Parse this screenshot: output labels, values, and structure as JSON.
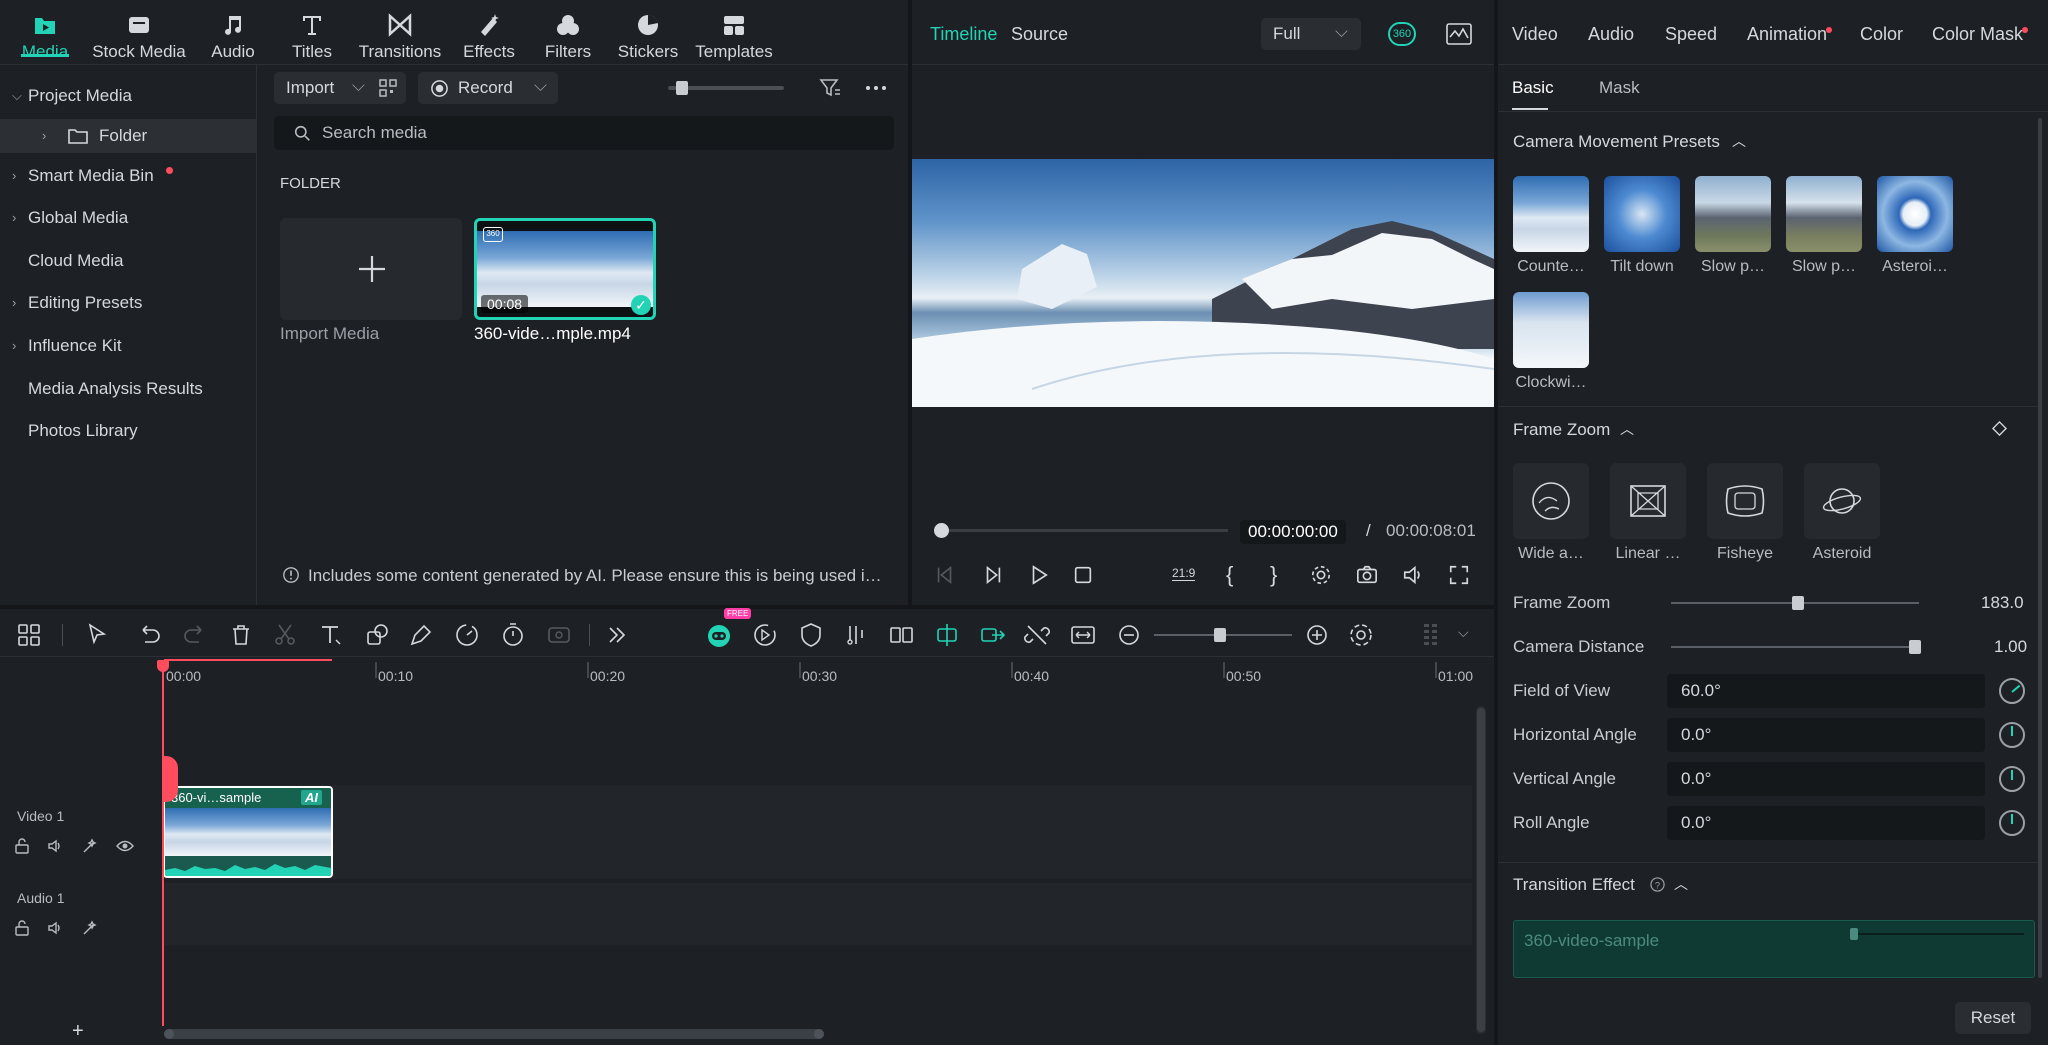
{
  "media_tabs": [
    {
      "label": "Media",
      "icon": "media-folder-icon",
      "active": true
    },
    {
      "label": "Stock Media",
      "icon": "stock-media-icon"
    },
    {
      "label": "Audio",
      "icon": "music-note-icon"
    },
    {
      "label": "Titles",
      "icon": "titles-icon"
    },
    {
      "label": "Transitions",
      "icon": "transitions-icon"
    },
    {
      "label": "Effects",
      "icon": "effects-icon"
    },
    {
      "label": "Filters",
      "icon": "filters-icon"
    },
    {
      "label": "Stickers",
      "icon": "stickers-icon"
    },
    {
      "label": "Templates",
      "icon": "templates-icon"
    }
  ],
  "sidebar": {
    "items": [
      {
        "label": "Project Media"
      },
      {
        "label": "Folder"
      },
      {
        "label": "Smart Media Bin"
      },
      {
        "label": "Global Media"
      },
      {
        "label": "Cloud Media"
      },
      {
        "label": "Editing Presets"
      },
      {
        "label": "Influence Kit"
      },
      {
        "label": "Media Analysis Results"
      },
      {
        "label": "Photos Library"
      }
    ]
  },
  "media": {
    "import_label": "Import",
    "record_label": "Record",
    "search_placeholder": "Search media",
    "section_title": "FOLDER",
    "import_media_label": "Import Media",
    "clip_name": "360-vide…mple.mp4",
    "clip_duration": "00:08",
    "clip_badge": "360",
    "ai_notice": "Includes some content generated by AI. Please ensure this is being used i…"
  },
  "player": {
    "tab_timeline": "Timeline",
    "tab_source": "Source",
    "quality": "Full",
    "badge_360": "360",
    "current_time": "00:00:00:00",
    "separator": "/",
    "total_time": "00:00:08:01",
    "aspect_label": "21:9",
    "mark_in": "{",
    "mark_out": "}"
  },
  "timeline": {
    "ruler": [
      "00:00",
      "00:10",
      "00:20",
      "00:30",
      "00:40",
      "00:50",
      "01:00"
    ],
    "free_badge": "FREE",
    "video_track": "Video 1",
    "audio_track": "Audio 1",
    "clip_label": "360-vi…sample",
    "clip_ai": "AI",
    "add_track": "+"
  },
  "inspector": {
    "tabs": [
      {
        "label": "Video",
        "active": true
      },
      {
        "label": "Audio"
      },
      {
        "label": "Speed"
      },
      {
        "label": "Animation",
        "dot": true
      },
      {
        "label": "Color"
      },
      {
        "label": "Color Mask",
        "dot": true
      }
    ],
    "subtabs": {
      "basic": "Basic",
      "mask": "Mask"
    },
    "camera_presets_title": "Camera Movement Presets",
    "presets": [
      {
        "label": "Counte…"
      },
      {
        "label": "Tilt down"
      },
      {
        "label": "Slow p…"
      },
      {
        "label": "Slow p…"
      },
      {
        "label": "Asteroi…"
      },
      {
        "label": "Clockwi…"
      }
    ],
    "frame_zoom_title": "Frame Zoom",
    "zoom_modes": [
      {
        "label": "Wide a…",
        "icon": "wide-angle-icon"
      },
      {
        "label": "Linear …",
        "icon": "linear-icon"
      },
      {
        "label": "Fisheye",
        "icon": "fisheye-icon"
      },
      {
        "label": "Asteroid",
        "icon": "asteroid-icon"
      }
    ],
    "frame_zoom_label": "Frame Zoom",
    "frame_zoom_value": "183.0",
    "camera_distance_label": "Camera Distance",
    "camera_distance_value": "1.00",
    "fov_label": "Field of View",
    "fov_value": "60.0°",
    "h_angle_label": "Horizontal Angle",
    "h_angle_value": "0.0°",
    "v_angle_label": "Vertical Angle",
    "v_angle_value": "0.0°",
    "roll_label": "Roll Angle",
    "roll_value": "0.0°",
    "transition_title": "Transition Effect",
    "transition_clip": "360-video-sample",
    "reset_label": "Reset"
  },
  "colors": {
    "accent": "#22d3b5",
    "panel": "#1d2024",
    "background": "#141619",
    "alert": "#ff4d5e"
  }
}
